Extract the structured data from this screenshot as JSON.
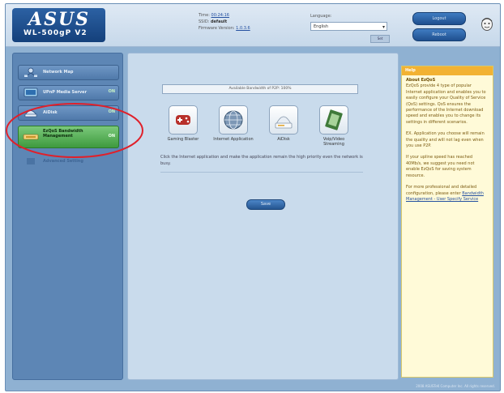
{
  "header": {
    "logo": "ASUS",
    "model": "WL-500gP V2",
    "time_label": "Time:",
    "time_value": "00:24:16",
    "ssid_label": "SSID:",
    "ssid_value": "default",
    "firmware_label": "Firmware Version:",
    "firmware_value": "1.0.3.6",
    "language_label": "Language:",
    "language_value": "English",
    "set_label": "Set",
    "logout_label": "Logout",
    "reboot_label": "Reboot"
  },
  "sidebar": {
    "items": [
      {
        "label": "Network Map",
        "tag": ""
      },
      {
        "label": "UPnP Media Server",
        "tag": "ON"
      },
      {
        "label": "AiDisk",
        "tag": "ON"
      },
      {
        "label": "EzQoS Bandwidth Management",
        "tag": "ON"
      },
      {
        "label": "Advanced Setting",
        "tag": ""
      }
    ]
  },
  "main": {
    "status": "Available Bandwidth of P2P: 100%",
    "apps": [
      {
        "name": "Gaming Blaster"
      },
      {
        "name": "Internet Application"
      },
      {
        "name": "AiDisk"
      },
      {
        "name": "Voip/Video Streaming"
      }
    ],
    "hint": "Click the Internet application and make the application remain the high priority even the network is busy.",
    "save_label": "Save"
  },
  "help": {
    "header": "Help",
    "title": "About EzQoS",
    "p1": "EzQoS provide 4 type of popular Internet application and enables you to easily configure your Quality of Service (QoS) settings. QoS ensures the performance of the Internet download speed and enables you to change its settings in different scenarios.",
    "p2": "EX. Application you choose will remain the quality and will not lag even when you use P2P.",
    "p3": "If your upline speed has reached 40Mb/s, we suggest you need not enable EzQoS for saving system resource.",
    "p4": "For more professional and detailed configuration, please enter",
    "link": "Bandwidth Management - User Specify Service"
  },
  "footer": "2008 ASUSTeK Computer Inc. All rights reserved.",
  "colors": {
    "accent": "#2c61a3",
    "active_nav": "#4fae4f",
    "annotation": "#e0202a"
  }
}
